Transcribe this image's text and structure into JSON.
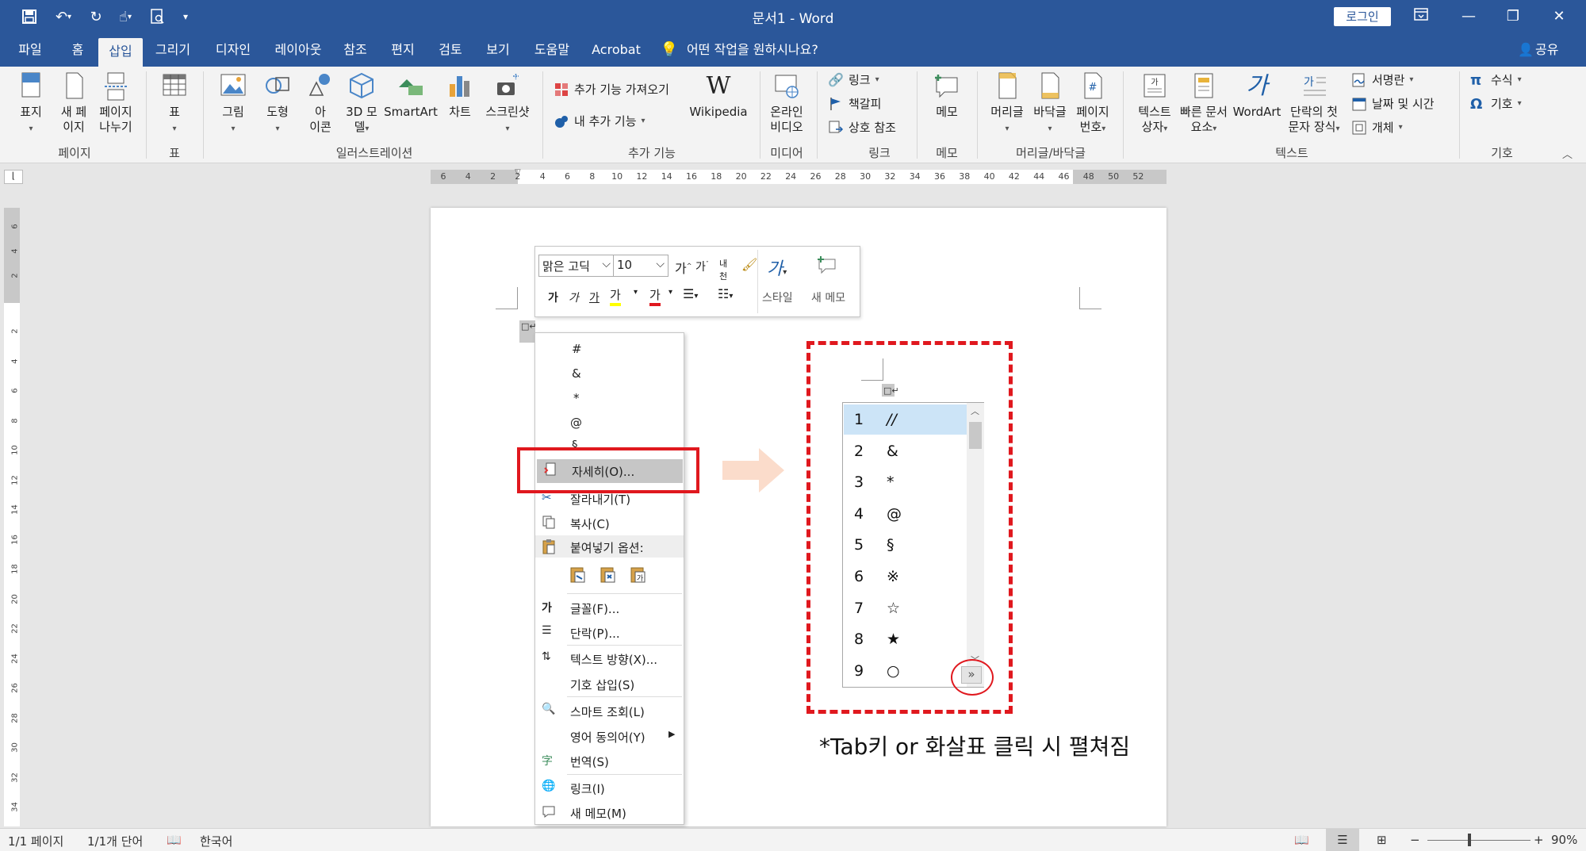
{
  "window": {
    "title": "문서1  -  Word",
    "login": "로그인",
    "tell_me": "어떤 작업을 원하시나요?",
    "share": "공유"
  },
  "tabs": [
    "파일",
    "홈",
    "삽입",
    "그리기",
    "디자인",
    "레이아웃",
    "참조",
    "편지",
    "검토",
    "보기",
    "도움말",
    "Acrobat"
  ],
  "active_tab": "삽입",
  "ribbon": {
    "groups": {
      "pages": "페이지",
      "tables": "표",
      "illustrations": "일러스트레이션",
      "addins": "추가 기능",
      "media": "미디어",
      "links": "링크",
      "comments": "메모",
      "header_footer": "머리글/바닥글",
      "text": "텍스트",
      "symbols": "기호"
    },
    "buttons": {
      "cover": "표지",
      "blank1": "새 페",
      "blank2": "이지",
      "break1": "페이지",
      "break2": "나누기",
      "table": "표",
      "picture": "그림",
      "shapes": "도형",
      "icons1": "아",
      "icons2": "이콘",
      "model1": "3D 모",
      "model2": "델",
      "smartart": "SmartArt",
      "chart": "차트",
      "screenshot": "스크린샷",
      "get_addins": "추가 기능 가져오기",
      "my_addins": "내 추가 기능",
      "wikipedia": "Wikipedia",
      "video1": "온라인",
      "video2": "비디오",
      "link": "링크",
      "bookmark": "책갈피",
      "crossref": "상호 참조",
      "comment": "메모",
      "header": "머리글",
      "footer": "바닥글",
      "pagenum1": "페이지",
      "pagenum2": "번호",
      "textbox1": "텍스트",
      "textbox2": "상자",
      "quickparts1": "빠른 문서",
      "quickparts2": "요소",
      "wordart": "WordArt",
      "dropcap1": "단락의 첫",
      "dropcap2": "문자 장식",
      "signature": "서명란",
      "datetime": "날짜 및 시간",
      "object": "개체",
      "equation": "수식",
      "symbol": "기호"
    }
  },
  "ruler": {
    "numbers": [
      "6",
      "4",
      "2",
      "2",
      "4",
      "6",
      "8",
      "10",
      "12",
      "14",
      "16",
      "18",
      "20",
      "22",
      "24",
      "26",
      "28",
      "30",
      "32",
      "34",
      "36",
      "38",
      "40",
      "42",
      "44",
      "46",
      "48",
      "50",
      "52"
    ],
    "vnumbers": [
      "2",
      "4",
      "6",
      "8",
      "10",
      "12",
      "14",
      "16",
      "18",
      "20",
      "22",
      "24",
      "26",
      "28",
      "30",
      "32",
      "34"
    ],
    "vnumbers_top": [
      "6",
      "4",
      "2"
    ]
  },
  "mini_toolbar": {
    "font": "맑은 고딕",
    "size": "10",
    "style": "스타일",
    "new_comment": "새 메모"
  },
  "context_menu": {
    "symbols": [
      "#",
      "&",
      "*",
      "@",
      "§"
    ],
    "more": "자세히(O)...",
    "cut": "잘라내기(T)",
    "copy": "복사(C)",
    "paste_options": "붙여넣기 옵션:",
    "font": "글꼴(F)...",
    "paragraph": "단락(P)...",
    "text_direction": "텍스트 방향(X)...",
    "insert_symbol": "기호 삽입(S)",
    "smart_lookup": "스마트 조회(L)",
    "synonyms": "영어 동의어(Y)",
    "translate": "번역(S)",
    "link": "링크(I)",
    "new_comment": "새 메모(M)"
  },
  "autocomplete": {
    "items": [
      {
        "num": "1",
        "sym": "//"
      },
      {
        "num": "2",
        "sym": "&"
      },
      {
        "num": "3",
        "sym": "*"
      },
      {
        "num": "4",
        "sym": "@"
      },
      {
        "num": "5",
        "sym": "§"
      },
      {
        "num": "6",
        "sym": "※"
      },
      {
        "num": "7",
        "sym": "☆"
      },
      {
        "num": "8",
        "sym": "★"
      },
      {
        "num": "9",
        "sym": "○"
      }
    ],
    "expand": "»"
  },
  "note": "*Tab키 or 화살표 클릭 시 펼쳐짐",
  "status": {
    "page": "1/1 페이지",
    "words": "1/1개 단어",
    "language": "한국어",
    "zoom": "90%"
  },
  "colors": {
    "brand": "#2b579a",
    "highlight_red": "#e0181e",
    "selection_blue": "#cce4f7"
  }
}
